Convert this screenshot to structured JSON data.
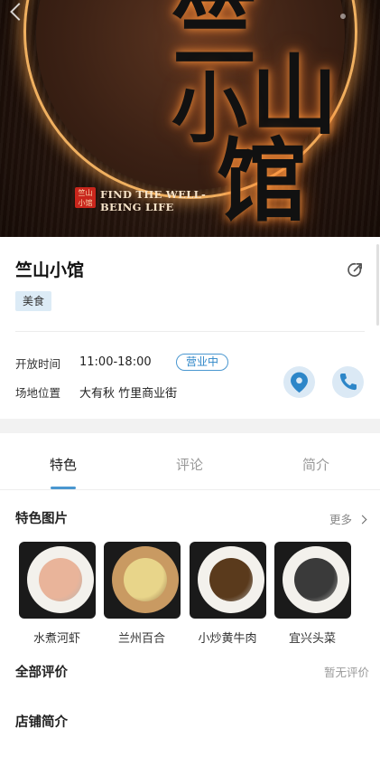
{
  "hero": {
    "glyphs": [
      "竺",
      "山",
      "小",
      "馆"
    ],
    "seal_text": "竺山小馆",
    "logo_line1": "FIND THE WELL-",
    "logo_line2": "BEING LIFE"
  },
  "venue": {
    "name": "竺山小馆",
    "tag": "美食"
  },
  "info": {
    "hours_label": "开放时间",
    "hours_value": "11:00-18:00",
    "status": "营业中",
    "location_label": "场地位置",
    "location_value": "大有秋 竹里商业街"
  },
  "tabs": [
    "特色",
    "评论",
    "简介"
  ],
  "featured": {
    "title": "特色图片",
    "more": "更多",
    "dishes": [
      {
        "name": "水煮河虾",
        "color": "#e9b49a"
      },
      {
        "name": "兰州百合",
        "color": "#e8d58a"
      },
      {
        "name": "小炒黄牛肉",
        "color": "#5a3a1c"
      },
      {
        "name": "宜兴头菜",
        "color": "#3a3a3a"
      }
    ]
  },
  "reviews": {
    "title": "全部评价",
    "empty": "暂无评价"
  },
  "intro": {
    "title": "店铺简介"
  },
  "colors": {
    "accent": "#4a97d0",
    "tag_bg": "#dcebf6"
  }
}
